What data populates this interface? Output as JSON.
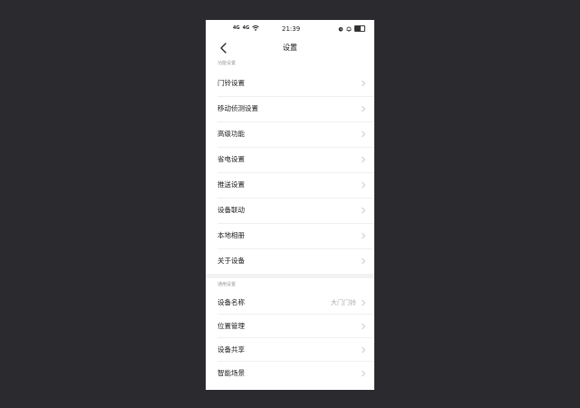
{
  "status_bar": {
    "signal_1": "4G",
    "signal_2": "4G",
    "time": "21:39",
    "battery_level": 0.6
  },
  "nav": {
    "title": "设置"
  },
  "sections": [
    {
      "header": "功能设置",
      "items": [
        {
          "label": "门铃设置",
          "value": ""
        },
        {
          "label": "移动侦测设置",
          "value": ""
        },
        {
          "label": "高级功能",
          "value": ""
        },
        {
          "label": "省电设置",
          "value": ""
        },
        {
          "label": "推送设置",
          "value": ""
        },
        {
          "label": "设备联动",
          "value": ""
        },
        {
          "label": "本地相册",
          "value": ""
        },
        {
          "label": "关于设备",
          "value": ""
        }
      ]
    },
    {
      "header": "通用设置",
      "items": [
        {
          "label": "设备名称",
          "value": "大门门铃"
        },
        {
          "label": "位置管理",
          "value": ""
        },
        {
          "label": "设备共享",
          "value": ""
        },
        {
          "label": "智能场景",
          "value": ""
        }
      ]
    }
  ]
}
